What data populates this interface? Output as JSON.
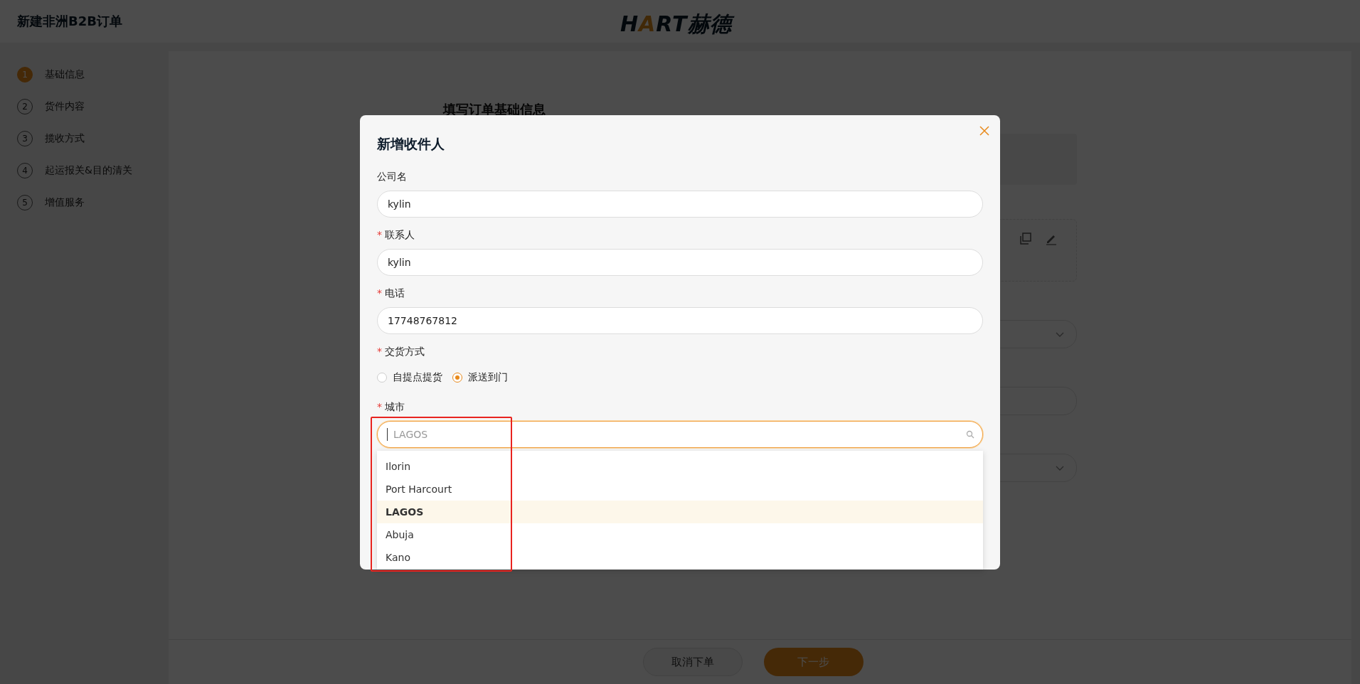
{
  "header": {
    "title": "新建非洲B2B订单",
    "logo": {
      "parts": [
        {
          "text": "H",
          "accent": false
        },
        {
          "text": "A",
          "accent": true
        },
        {
          "text": "RT",
          "accent": false
        }
      ],
      "cjk": "赫德"
    }
  },
  "steps": [
    {
      "number": "1",
      "label": "基础信息",
      "selected": true
    },
    {
      "number": "2",
      "label": "货件内容",
      "selected": false
    },
    {
      "number": "3",
      "label": "揽收方式",
      "selected": false
    },
    {
      "number": "4",
      "label": "起运报关&目的清关",
      "selected": false
    },
    {
      "number": "5",
      "label": "增值服务",
      "selected": false
    }
  ],
  "main": {
    "title": "填写订单基础信息"
  },
  "footer": {
    "buttons": [
      {
        "label": "取消下单",
        "kind": "secondary"
      },
      {
        "label": "下一步",
        "kind": "primary"
      }
    ]
  },
  "modal": {
    "title": "新增收件人",
    "fields": [
      {
        "label": "公司名",
        "value": "kylin"
      },
      {
        "label": "联系人",
        "mark": "*",
        "value": "kylin"
      },
      {
        "label": "电话",
        "mark": "*",
        "value": "17748767812"
      }
    ],
    "delivery": {
      "label": "交货方式",
      "mark": "*",
      "options": [
        {
          "label": "自提点提货",
          "selected": false
        },
        {
          "label": "派送到门",
          "selected": true
        }
      ]
    },
    "city": {
      "label": "城市",
      "mark": "*",
      "placeholder": "LAGOS",
      "options": [
        {
          "label": "Ilorin",
          "selected": false
        },
        {
          "label": "Port Harcourt",
          "selected": false
        },
        {
          "label": "LAGOS",
          "selected": true
        },
        {
          "label": "Abuja",
          "selected": false
        },
        {
          "label": "Kano",
          "selected": false
        }
      ]
    }
  }
}
